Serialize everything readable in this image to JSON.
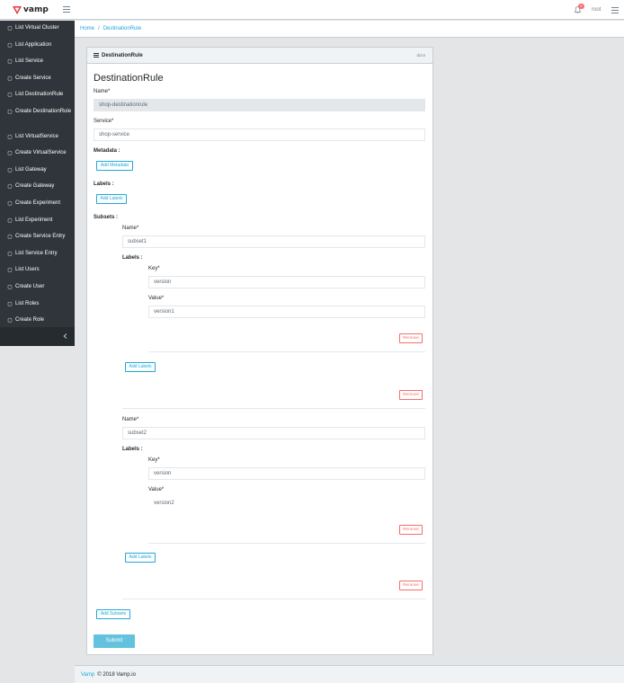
{
  "header": {
    "brand": "vamp",
    "notification_count": "5",
    "user": "root"
  },
  "sidebar": {
    "items": [
      {
        "label": "List Virtual Cluster"
      },
      {
        "label": "List Application"
      },
      {
        "label": "List Service"
      },
      {
        "label": "Create Service"
      },
      {
        "label": "List DestinationRule"
      },
      {
        "label": "Create DestinationRule"
      },
      {
        "label": "List VirtualService"
      },
      {
        "label": "Create VirtualService"
      },
      {
        "label": "List Gateway"
      },
      {
        "label": "Create Gateway"
      },
      {
        "label": "Create Experiment"
      },
      {
        "label": "List Experiment"
      },
      {
        "label": "Create Service Entry"
      },
      {
        "label": "List Service Entry"
      },
      {
        "label": "List Users"
      },
      {
        "label": "Create User"
      },
      {
        "label": "List Roles"
      },
      {
        "label": "Create Role"
      }
    ]
  },
  "breadcrumb": {
    "home": "Home",
    "separator": "/",
    "current": "DestinationRule"
  },
  "card": {
    "title": "DestinationRule",
    "action": "docs"
  },
  "form": {
    "title": "DestinationRule",
    "name_label": "Name*",
    "name_value": "shop-destinationrule",
    "service_label": "Service*",
    "service_value": "shop-service",
    "metadata_label": "Metadata :",
    "add_metadata": "Add Metadata",
    "labels_label": "Labels :",
    "add_labels": "Add Labels",
    "subsets_label": "Subsets :",
    "subsets": [
      {
        "name_label": "Name*",
        "name_value": "subset1",
        "labels_label": "Labels :",
        "key_label": "Key*",
        "key_value": "version",
        "value_label": "Value*",
        "value_value": "version1",
        "remove_label": "Remove",
        "add_labels": "Add Labels",
        "remove_subset": "Remove"
      },
      {
        "name_label": "Name*",
        "name_value": "subset2",
        "labels_label": "Labels :",
        "key_label": "Key*",
        "key_value": "version",
        "value_label": "Value*",
        "value_value": "version2",
        "remove_label": "Remove",
        "add_labels": "Add Labels",
        "remove_subset": "Remove"
      }
    ],
    "add_subsets": "Add Subsets",
    "submit": "Submit"
  },
  "footer": {
    "link": "Vamp",
    "text": "© 2018 Vamp.io"
  },
  "colors": {
    "accent": "#20a8d8",
    "danger": "#f86c6b",
    "sidebar": "#2f353a",
    "submit": "#63c2de",
    "brand": "#e5373b"
  }
}
